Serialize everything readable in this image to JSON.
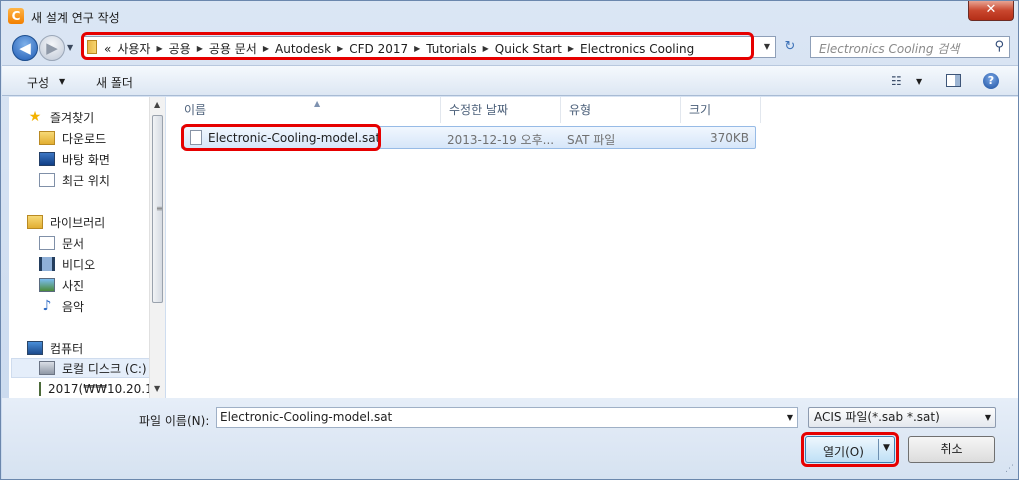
{
  "window": {
    "title": "새 설계 연구 작성",
    "app_icon_letter": "C",
    "close_glyph": "✕"
  },
  "address": {
    "overflow": "«",
    "crumbs": [
      "사용자",
      "공용",
      "공용 문서",
      "Autodesk",
      "CFD 2017",
      "Tutorials",
      "Quick Start",
      "Electronics Cooling"
    ],
    "separator": "▶",
    "dropdown": "▼",
    "refresh": "↻"
  },
  "search": {
    "placeholder": "Electronics Cooling 검색",
    "icon": "⚲"
  },
  "commandbar": {
    "organize": "구성",
    "organize_caret": "▼",
    "new_folder": "새 폴더",
    "view_icon": "☷",
    "view_caret": "▼",
    "help": "?"
  },
  "nav": {
    "items": [
      {
        "label": "즐겨찾기",
        "icon": "star-icon",
        "glyph": "★"
      },
      {
        "label": "다운로드",
        "icon": "downloads-folder-icon",
        "glyph": ""
      },
      {
        "label": "바탕 화면",
        "icon": "desktop-icon",
        "glyph": ""
      },
      {
        "label": "최근 위치",
        "icon": "recent-places-icon",
        "glyph": ""
      },
      {
        "label": "라이브러리",
        "icon": "library-icon",
        "glyph": ""
      },
      {
        "label": "문서",
        "icon": "documents-icon",
        "glyph": ""
      },
      {
        "label": "비디오",
        "icon": "video-icon",
        "glyph": ""
      },
      {
        "label": "사진",
        "icon": "pictures-icon",
        "glyph": ""
      },
      {
        "label": "음악",
        "icon": "music-icon",
        "glyph": "♪"
      },
      {
        "label": "컴퓨터",
        "icon": "computer-icon",
        "glyph": ""
      },
      {
        "label": "로컬 디스크 (C:)",
        "icon": "local-disk-icon",
        "glyph": ""
      },
      {
        "label": "2017(₩₩10.20.1",
        "icon": "network-drive-icon",
        "glyph": ""
      }
    ],
    "scroll_up": "▲",
    "scroll_down": "▼",
    "grip": "≡"
  },
  "columns": {
    "name": "이름",
    "modified": "수정한 날짜",
    "type": "유형",
    "size": "크기",
    "sort_caret": "▲"
  },
  "files": [
    {
      "name": "Electronic-Cooling-model.sat",
      "modified": "2013-12-19 오후...",
      "type": "SAT 파일",
      "size": "370KB"
    }
  ],
  "footer": {
    "filename_label": "파일 이름(N):",
    "filename_value": "Electronic-Cooling-model.sat",
    "filename_caret": "▼",
    "filetype_value": "ACIS 파일(*.sab *.sat)",
    "filetype_caret": "▼",
    "open_label": "열기(O)",
    "open_caret": "▼",
    "cancel_label": "취소",
    "resize_grip": "⋰"
  },
  "colors": {
    "highlight": "#e60000",
    "selection": "#d6e6f9",
    "accent": "#1f5bb4"
  }
}
